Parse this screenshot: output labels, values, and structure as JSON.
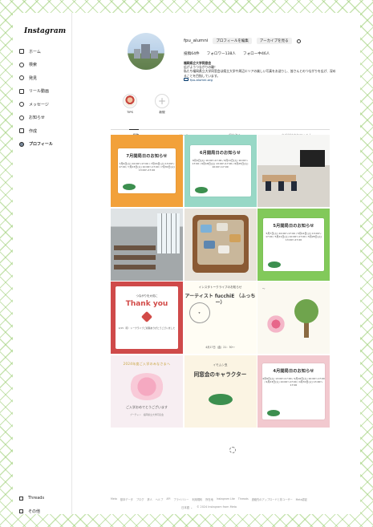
{
  "app": {
    "logo": "Instagram"
  },
  "sidebar": {
    "items": [
      {
        "label": "ホーム",
        "icon": "home-icon"
      },
      {
        "label": "検索",
        "icon": "search-icon"
      },
      {
        "label": "発見",
        "icon": "explore-icon"
      },
      {
        "label": "リール動画",
        "icon": "reels-icon"
      },
      {
        "label": "メッセージ",
        "icon": "messages-icon"
      },
      {
        "label": "お知らせ",
        "icon": "heart-icon"
      },
      {
        "label": "作成",
        "icon": "create-icon"
      },
      {
        "label": "プロフィール",
        "icon": "avatar-icon"
      }
    ],
    "threads": "Threads",
    "more": "その他"
  },
  "profile": {
    "username": "fpu_alumni",
    "edit_button": "プロフィールを編集",
    "archive_button": "アーカイブを見る",
    "posts": "投稿64件",
    "followers": "フォロワー138人",
    "following": "フォロー中46人",
    "bio_name": "福岡県立大学同窓会",
    "bio_line1": "広げようつながりの輪！",
    "bio_line2": "私たち福岡県立大学同窓会は県立大学や周辺エリアの楽しい写真をお送りし、皆さんとのつながりを広げ、深めることを目指しています。",
    "bio_link": "fpu-alumni.org"
  },
  "highlights": [
    {
      "label": "TIPS"
    },
    {
      "label": "新規"
    }
  ],
  "tabs": [
    {
      "label": "投稿",
      "active": true
    },
    {
      "label": "リール",
      "active": false
    },
    {
      "label": "保存済み",
      "active": false
    },
    {
      "label": "タグ付けされている人",
      "active": false
    }
  ],
  "posts": {
    "p1": {
      "title": "7月開局日のお知らせ",
      "sched": "7月9日(火) 10:00〜17:00 / 7月16日(火) 13:00〜17:00 / 7月23日(火) 10:00〜17:00 / 7月30日(火) 13:00〜17:00"
    },
    "p2": {
      "title": "6月開局日のお知らせ",
      "sched": "6月4日(火) 10:00〜17:00 / 6月11日(火) 10:00〜17:00 / 6月18日(火) 13:00〜17:00 / 6月25日(火) 10:00〜17:00"
    },
    "p6": {
      "title": "5月開局日のお知らせ",
      "sched": "5月7日(火) 10:00〜17:00 / 5月14日(火) 13:00〜17:00 / 5月21日(火) 10:00〜17:00 / 5月28日(火) 13:00〜17:00"
    },
    "p7": {
      "top": "つながりを大切に",
      "big": "Thank you",
      "bot": "4/15（月）トークライブご視聴ありがとうございました"
    },
    "p8": {
      "hdr": "インスタトークライブのお知らせ",
      "name": "アーティスト fucchiE （ふっちー）",
      "date": "4月17日（金）21：30〜"
    },
    "p10": {
      "t": "2024年度ご入学のみなさまへ",
      "m": "ご入学おめでとうございます",
      "m2": "ブーチャン　福岡県立大学同窓会"
    },
    "p11": {
      "s": "イモムシ虫",
      "t": "同窓会のキャラクター"
    },
    "p12": {
      "title": "4月開局日のお知らせ",
      "sched": "4月9日(火) 13:00〜17:00 / 4月16日(火) 10:00〜17:00 / 4月23日(火) 10:00〜17:00 / 4月30日(火) 13:00〜17:00"
    }
  },
  "footer": {
    "links": [
      "Meta",
      "基本データ",
      "ブログ",
      "求人",
      "ヘルプ",
      "API",
      "プライバシー",
      "利用規約",
      "所在地",
      "Instagram Lite",
      "Threads",
      "連絡先のアップロードと非ユーザー",
      "Meta認証"
    ],
    "language": "日本語",
    "copyright": "© 2024 Instagram from Meta"
  },
  "colors": {
    "accent": "#99cd70",
    "red": "#d24b48"
  }
}
